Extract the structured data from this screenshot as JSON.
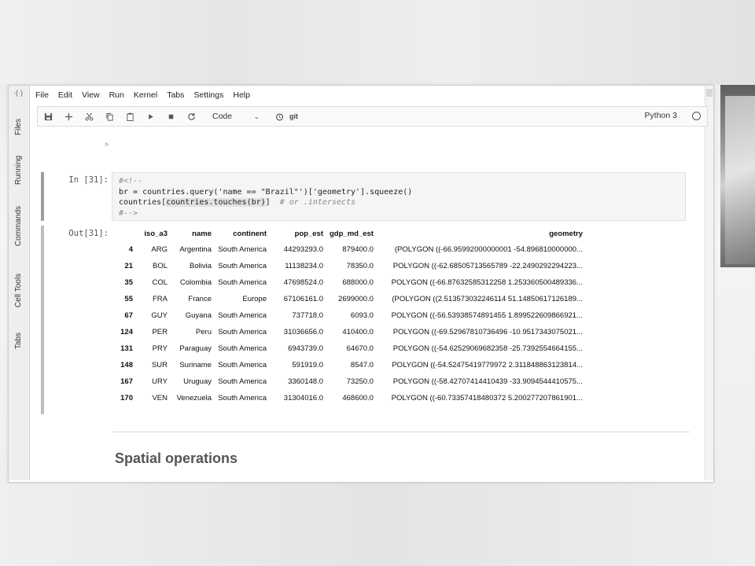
{
  "menu": [
    "File",
    "Edit",
    "View",
    "Run",
    "Kernel",
    "Tabs",
    "Settings",
    "Help"
  ],
  "sidebar_tabs": [
    "Files",
    "Running",
    "Commands",
    "Cell Tools",
    "Tabs"
  ],
  "toolbar": {
    "cell_type": "Code",
    "git_label": "git",
    "kernel_name": "Python 3"
  },
  "cell_in": {
    "prompt": "In [31]:",
    "lines": [
      {
        "pre": "#<!--",
        "hl": "",
        "post": ""
      },
      {
        "pre": "br = countries.query('name == \"Brazil\"')['geometry'].squeeze()",
        "hl": "",
        "post": ""
      },
      {
        "pre": "countries[",
        "hl": "countries.touches(br)",
        "post": "]"
      },
      {
        "pre": "#-->",
        "hl": "",
        "post": ""
      }
    ],
    "trailing_comment": "# or .intersects"
  },
  "cell_out": {
    "prompt": "Out[31]:",
    "columns": [
      "",
      "iso_a3",
      "name",
      "continent",
      "pop_est",
      "gdp_md_est",
      "geometry"
    ],
    "rows": [
      [
        "4",
        "ARG",
        "Argentina",
        "South America",
        "44293293.0",
        "879400.0",
        "(POLYGON ((-66.95992000000001 -54.896810000000..."
      ],
      [
        "21",
        "BOL",
        "Bolivia",
        "South America",
        "11138234.0",
        "78350.0",
        "POLYGON ((-62.68505713565789 -22.2490292294223..."
      ],
      [
        "35",
        "COL",
        "Colombia",
        "South America",
        "47698524.0",
        "688000.0",
        "POLYGON ((-66.87632585312258 1.253360500489336..."
      ],
      [
        "55",
        "FRA",
        "France",
        "Europe",
        "67106161.0",
        "2699000.0",
        "(POLYGON ((2.513573032246114 51.14850617126189..."
      ],
      [
        "67",
        "GUY",
        "Guyana",
        "South America",
        "737718.0",
        "6093.0",
        "POLYGON ((-56.53938574891455 1.899522609866921..."
      ],
      [
        "124",
        "PER",
        "Peru",
        "South America",
        "31036656.0",
        "410400.0",
        "POLYGON ((-69.52967810736496 -10.9517343075021..."
      ],
      [
        "131",
        "PRY",
        "Paraguay",
        "South America",
        "6943739.0",
        "64670.0",
        "POLYGON ((-54.62529069682358 -25.7392554664155..."
      ],
      [
        "148",
        "SUR",
        "Suriname",
        "South America",
        "591919.0",
        "8547.0",
        "POLYGON ((-54.52475419779972 2.311848863123814..."
      ],
      [
        "167",
        "URY",
        "Uruguay",
        "South America",
        "3360148.0",
        "73250.0",
        "POLYGON ((-58.42707414410439 -33.9094544410575..."
      ],
      [
        "170",
        "VEN",
        "Venezuela",
        "South America",
        "31304016.0",
        "468600.0",
        "POLYGON ((-60.73357418480372 5.200277207861901..."
      ]
    ]
  },
  "markdown": {
    "heading": "Spatial operations"
  }
}
